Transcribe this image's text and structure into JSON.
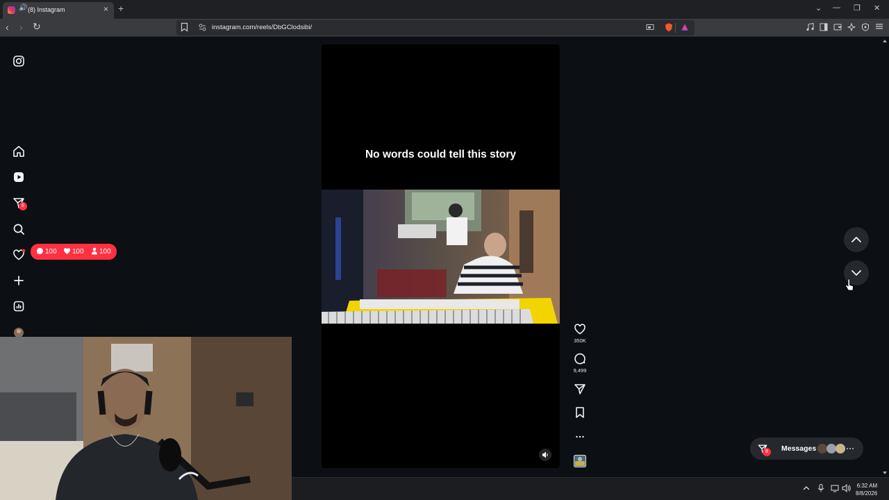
{
  "browser": {
    "tab_title": "(8) Instagram",
    "url": "instagram.com/reels/DbGClodsibi/",
    "new_tab_symbol": "+",
    "tab_close_symbol": "×"
  },
  "sidebar": {
    "messages_badge": "8",
    "notifications": {
      "comments": "100",
      "likes": "100",
      "follows": "100"
    }
  },
  "reel": {
    "caption": "No words could tell this story",
    "likes_count": "350K",
    "comments_count": "9,499"
  },
  "messages_widget": {
    "label": "Messages",
    "badge": "8"
  },
  "taskbar": {
    "time": "6:32 AM",
    "date": "8/8/2026"
  },
  "colors": {
    "background": "#0c1014",
    "badge_red": "#ff3040",
    "keyboard_yellow": "#f2d400"
  }
}
